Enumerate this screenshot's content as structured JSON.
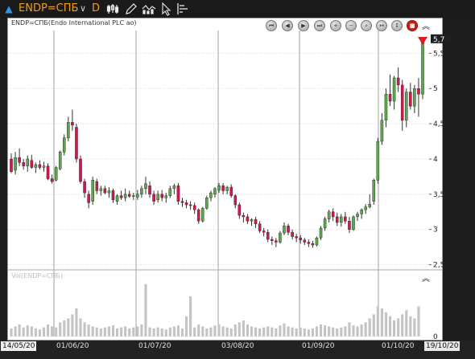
{
  "toolbar": {
    "symbol": "ENDP=СПБ",
    "period": "D"
  },
  "chart": {
    "title": "ENDP=СПБ(Endo International PLC ao)",
    "volume_title": "Vol(ENDP=СПБ)",
    "last_price_tag": "5,7"
  },
  "colors": {
    "up": "#5da64b",
    "down": "#d3174c",
    "volume": "#c4c4c4",
    "symbol": "#f19d1e"
  },
  "icons": [
    "up-arrow-icon",
    "chevron-down-icon",
    "chart-type-icon",
    "pen-icon",
    "indicators-icon",
    "cursor-icon",
    "layout-icon",
    "scroll-start-icon",
    "scroll-left-icon",
    "scroll-right-icon",
    "scroll-end-icon",
    "zoom-in-icon",
    "zoom-out-icon",
    "zoom-fit-icon",
    "zoom-horizontal-icon",
    "zoom-vertical-icon",
    "stop-icon",
    "collapse-icon"
  ],
  "chart_data": {
    "type": "candlestick",
    "title": "ENDP=СПБ(Endo International PLC ao)",
    "x_axis": {
      "ticks": [
        "14/05/20",
        "01/06/20",
        "01/07/20",
        "03/08/20",
        "01/09/20",
        "01/10/20",
        "19/10/20"
      ],
      "range": [
        "14/05/20",
        "19/10/20"
      ]
    },
    "y_axis": {
      "ticks": [
        "2,5",
        "3",
        "3,5",
        "4",
        "4,5",
        "5",
        "5,5"
      ],
      "range": [
        2.45,
        5.8
      ],
      "side": "right",
      "last_value_label": "5,7"
    },
    "volume_axis": {
      "ticks": [
        "0"
      ]
    },
    "candles_ohlc": [
      [
        4.0,
        4.08,
        3.8,
        3.82
      ],
      [
        3.84,
        4.1,
        3.78,
        4.02
      ],
      [
        4.02,
        4.15,
        3.9,
        3.95
      ],
      [
        3.95,
        4.0,
        3.85,
        3.9
      ],
      [
        3.9,
        4.05,
        3.82,
        4.0
      ],
      [
        3.98,
        4.06,
        3.86,
        3.88
      ],
      [
        3.88,
        3.95,
        3.8,
        3.92
      ],
      [
        3.92,
        3.98,
        3.85,
        3.88
      ],
      [
        3.88,
        3.96,
        3.82,
        3.9
      ],
      [
        3.9,
        3.94,
        3.7,
        3.72
      ],
      [
        3.72,
        3.78,
        3.65,
        3.68
      ],
      [
        3.7,
        3.9,
        3.68,
        3.88
      ],
      [
        3.86,
        4.12,
        3.84,
        4.1
      ],
      [
        4.1,
        4.35,
        4.05,
        4.3
      ],
      [
        4.3,
        4.6,
        4.25,
        4.52
      ],
      [
        4.52,
        4.7,
        4.4,
        4.48
      ],
      [
        4.45,
        4.5,
        3.95,
        4.0
      ],
      [
        4.0,
        4.05,
        3.65,
        3.68
      ],
      [
        3.68,
        3.72,
        3.45,
        3.52
      ],
      [
        3.5,
        3.55,
        3.3,
        3.38
      ],
      [
        3.4,
        3.75,
        3.35,
        3.7
      ],
      [
        3.68,
        3.72,
        3.5,
        3.55
      ],
      [
        3.55,
        3.62,
        3.48,
        3.58
      ],
      [
        3.58,
        3.62,
        3.5,
        3.52
      ],
      [
        3.52,
        3.6,
        3.45,
        3.55
      ],
      [
        3.55,
        3.58,
        3.38,
        3.42
      ],
      [
        3.4,
        3.5,
        3.35,
        3.48
      ],
      [
        3.48,
        3.55,
        3.42,
        3.45
      ],
      [
        3.45,
        3.58,
        3.4,
        3.5
      ],
      [
        3.5,
        3.55,
        3.45,
        3.47
      ],
      [
        3.47,
        3.52,
        3.42,
        3.48
      ],
      [
        3.46,
        3.56,
        3.42,
        3.5
      ],
      [
        3.5,
        3.62,
        3.45,
        3.58
      ],
      [
        3.58,
        3.75,
        3.5,
        3.65
      ],
      [
        3.62,
        3.68,
        3.45,
        3.5
      ],
      [
        3.5,
        3.55,
        3.35,
        3.4
      ],
      [
        3.42,
        3.55,
        3.38,
        3.5
      ],
      [
        3.5,
        3.56,
        3.4,
        3.45
      ],
      [
        3.45,
        3.52,
        3.38,
        3.48
      ],
      [
        3.48,
        3.62,
        3.45,
        3.58
      ],
      [
        3.58,
        3.65,
        3.5,
        3.62
      ],
      [
        3.62,
        3.66,
        3.35,
        3.4
      ],
      [
        3.4,
        3.45,
        3.32,
        3.38
      ],
      [
        3.38,
        3.42,
        3.3,
        3.35
      ],
      [
        3.35,
        3.4,
        3.28,
        3.34
      ],
      [
        3.34,
        3.38,
        3.22,
        3.28
      ],
      [
        3.28,
        3.3,
        3.08,
        3.12
      ],
      [
        3.12,
        3.32,
        3.1,
        3.3
      ],
      [
        3.3,
        3.48,
        3.28,
        3.45
      ],
      [
        3.45,
        3.55,
        3.4,
        3.52
      ],
      [
        3.5,
        3.6,
        3.45,
        3.58
      ],
      [
        3.56,
        3.66,
        3.52,
        3.62
      ],
      [
        3.62,
        3.66,
        3.5,
        3.55
      ],
      [
        3.55,
        3.62,
        3.5,
        3.6
      ],
      [
        3.6,
        3.64,
        3.45,
        3.48
      ],
      [
        3.48,
        3.5,
        3.3,
        3.35
      ],
      [
        3.35,
        3.38,
        3.15,
        3.2
      ],
      [
        3.2,
        3.24,
        3.1,
        3.18
      ],
      [
        3.18,
        3.22,
        3.08,
        3.12
      ],
      [
        3.12,
        3.16,
        3.05,
        3.14
      ],
      [
        3.14,
        3.18,
        3.02,
        3.08
      ],
      [
        3.08,
        3.12,
        2.95,
        2.98
      ],
      [
        2.98,
        3.02,
        2.9,
        2.96
      ],
      [
        2.96,
        3.0,
        2.82,
        2.86
      ],
      [
        2.86,
        2.9,
        2.78,
        2.84
      ],
      [
        2.84,
        2.88,
        2.75,
        2.82
      ],
      [
        2.82,
        2.98,
        2.8,
        2.95
      ],
      [
        2.95,
        3.1,
        2.92,
        3.05
      ],
      [
        3.05,
        3.08,
        2.92,
        2.96
      ],
      [
        2.96,
        3.0,
        2.86,
        2.9
      ],
      [
        2.9,
        2.94,
        2.82,
        2.88
      ],
      [
        2.88,
        2.92,
        2.8,
        2.85
      ],
      [
        2.85,
        2.88,
        2.78,
        2.82
      ],
      [
        2.82,
        2.86,
        2.75,
        2.8
      ],
      [
        2.8,
        2.84,
        2.74,
        2.78
      ],
      [
        2.78,
        2.9,
        2.76,
        2.88
      ],
      [
        2.88,
        3.05,
        2.85,
        3.02
      ],
      [
        3.02,
        3.18,
        2.98,
        3.15
      ],
      [
        3.15,
        3.28,
        3.1,
        3.25
      ],
      [
        3.25,
        3.3,
        3.12,
        3.18
      ],
      [
        3.18,
        3.24,
        3.05,
        3.1
      ],
      [
        3.1,
        3.22,
        3.04,
        3.18
      ],
      [
        3.18,
        3.25,
        3.08,
        3.12
      ],
      [
        3.12,
        3.18,
        2.95,
        3.0
      ],
      [
        3.0,
        3.2,
        2.98,
        3.18
      ],
      [
        3.18,
        3.25,
        3.12,
        3.22
      ],
      [
        3.22,
        3.3,
        3.15,
        3.28
      ],
      [
        3.28,
        3.36,
        3.22,
        3.32
      ],
      [
        3.32,
        3.5,
        3.3,
        3.36
      ],
      [
        3.4,
        3.72,
        3.35,
        3.7
      ],
      [
        3.7,
        4.3,
        3.65,
        4.25
      ],
      [
        4.25,
        4.65,
        4.2,
        4.55
      ],
      [
        4.55,
        5.0,
        4.45,
        4.92
      ],
      [
        4.92,
        5.2,
        4.75,
        4.82
      ],
      [
        4.82,
        5.18,
        4.7,
        5.15
      ],
      [
        5.15,
        5.3,
        4.95,
        5.05
      ],
      [
        5.05,
        5.12,
        4.4,
        4.55
      ],
      [
        4.55,
        5.0,
        4.45,
        4.95
      ],
      [
        4.95,
        5.08,
        4.7,
        4.75
      ],
      [
        4.75,
        5.05,
        4.65,
        5.0
      ],
      [
        5.0,
        5.15,
        4.6,
        4.92
      ],
      [
        4.92,
        5.7,
        4.85,
        5.7
      ]
    ],
    "volumes": [
      8,
      10,
      12,
      9,
      11,
      10,
      8,
      7,
      9,
      12,
      10,
      9,
      14,
      16,
      18,
      22,
      28,
      18,
      14,
      12,
      10,
      9,
      8,
      9,
      10,
      11,
      8,
      9,
      10,
      8,
      9,
      10,
      12,
      14,
      9,
      8,
      9,
      8,
      7,
      9,
      10,
      11,
      8,
      7,
      8,
      9,
      12,
      10,
      8,
      9,
      11,
      12,
      10,
      9,
      8,
      12,
      14,
      16,
      12,
      10,
      9,
      8,
      9,
      10,
      9,
      8,
      11,
      13,
      10,
      9,
      8,
      9,
      8,
      7,
      8,
      10,
      12,
      11,
      10,
      9,
      8,
      9,
      10,
      14,
      11,
      10,
      12,
      14,
      18,
      22,
      30,
      28,
      24,
      20,
      16,
      18,
      22,
      26,
      20,
      18,
      30
    ],
    "volumes_note": "",
    "volume_highlight_bars": {
      "33": 52,
      "43": 20,
      "44": 40
    }
  }
}
